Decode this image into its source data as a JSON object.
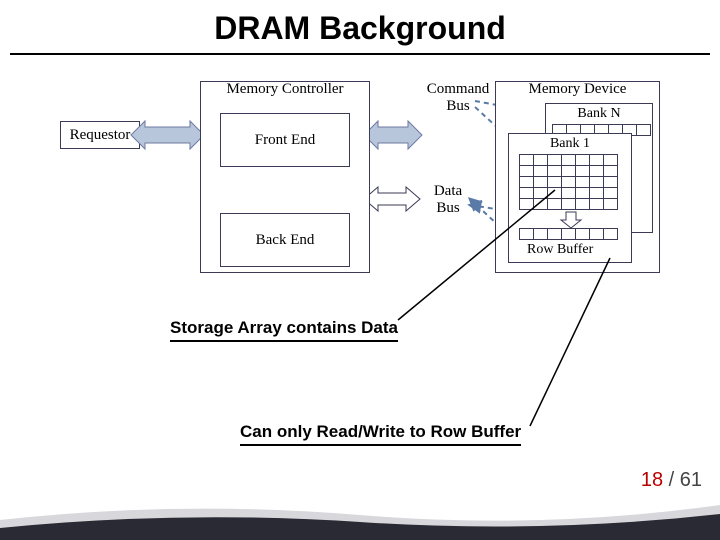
{
  "title": "DRAM Background",
  "diagram": {
    "requestor": "Requestor",
    "memory_controller": "Memory Controller",
    "front_end": "Front End",
    "back_end": "Back End",
    "command_bus": "Command\nBus",
    "data_bus": "Data\nBus",
    "memory_device": "Memory Device",
    "bank_n": "Bank N",
    "bank_1": "Bank 1",
    "row_buffer": "Row Buffer"
  },
  "annotations": {
    "storage_array": "Storage Array contains Data",
    "row_buffer_note": "Can only Read/Write to Row Buffer"
  },
  "page": {
    "current": "18",
    "sep": " / ",
    "total": "61"
  }
}
